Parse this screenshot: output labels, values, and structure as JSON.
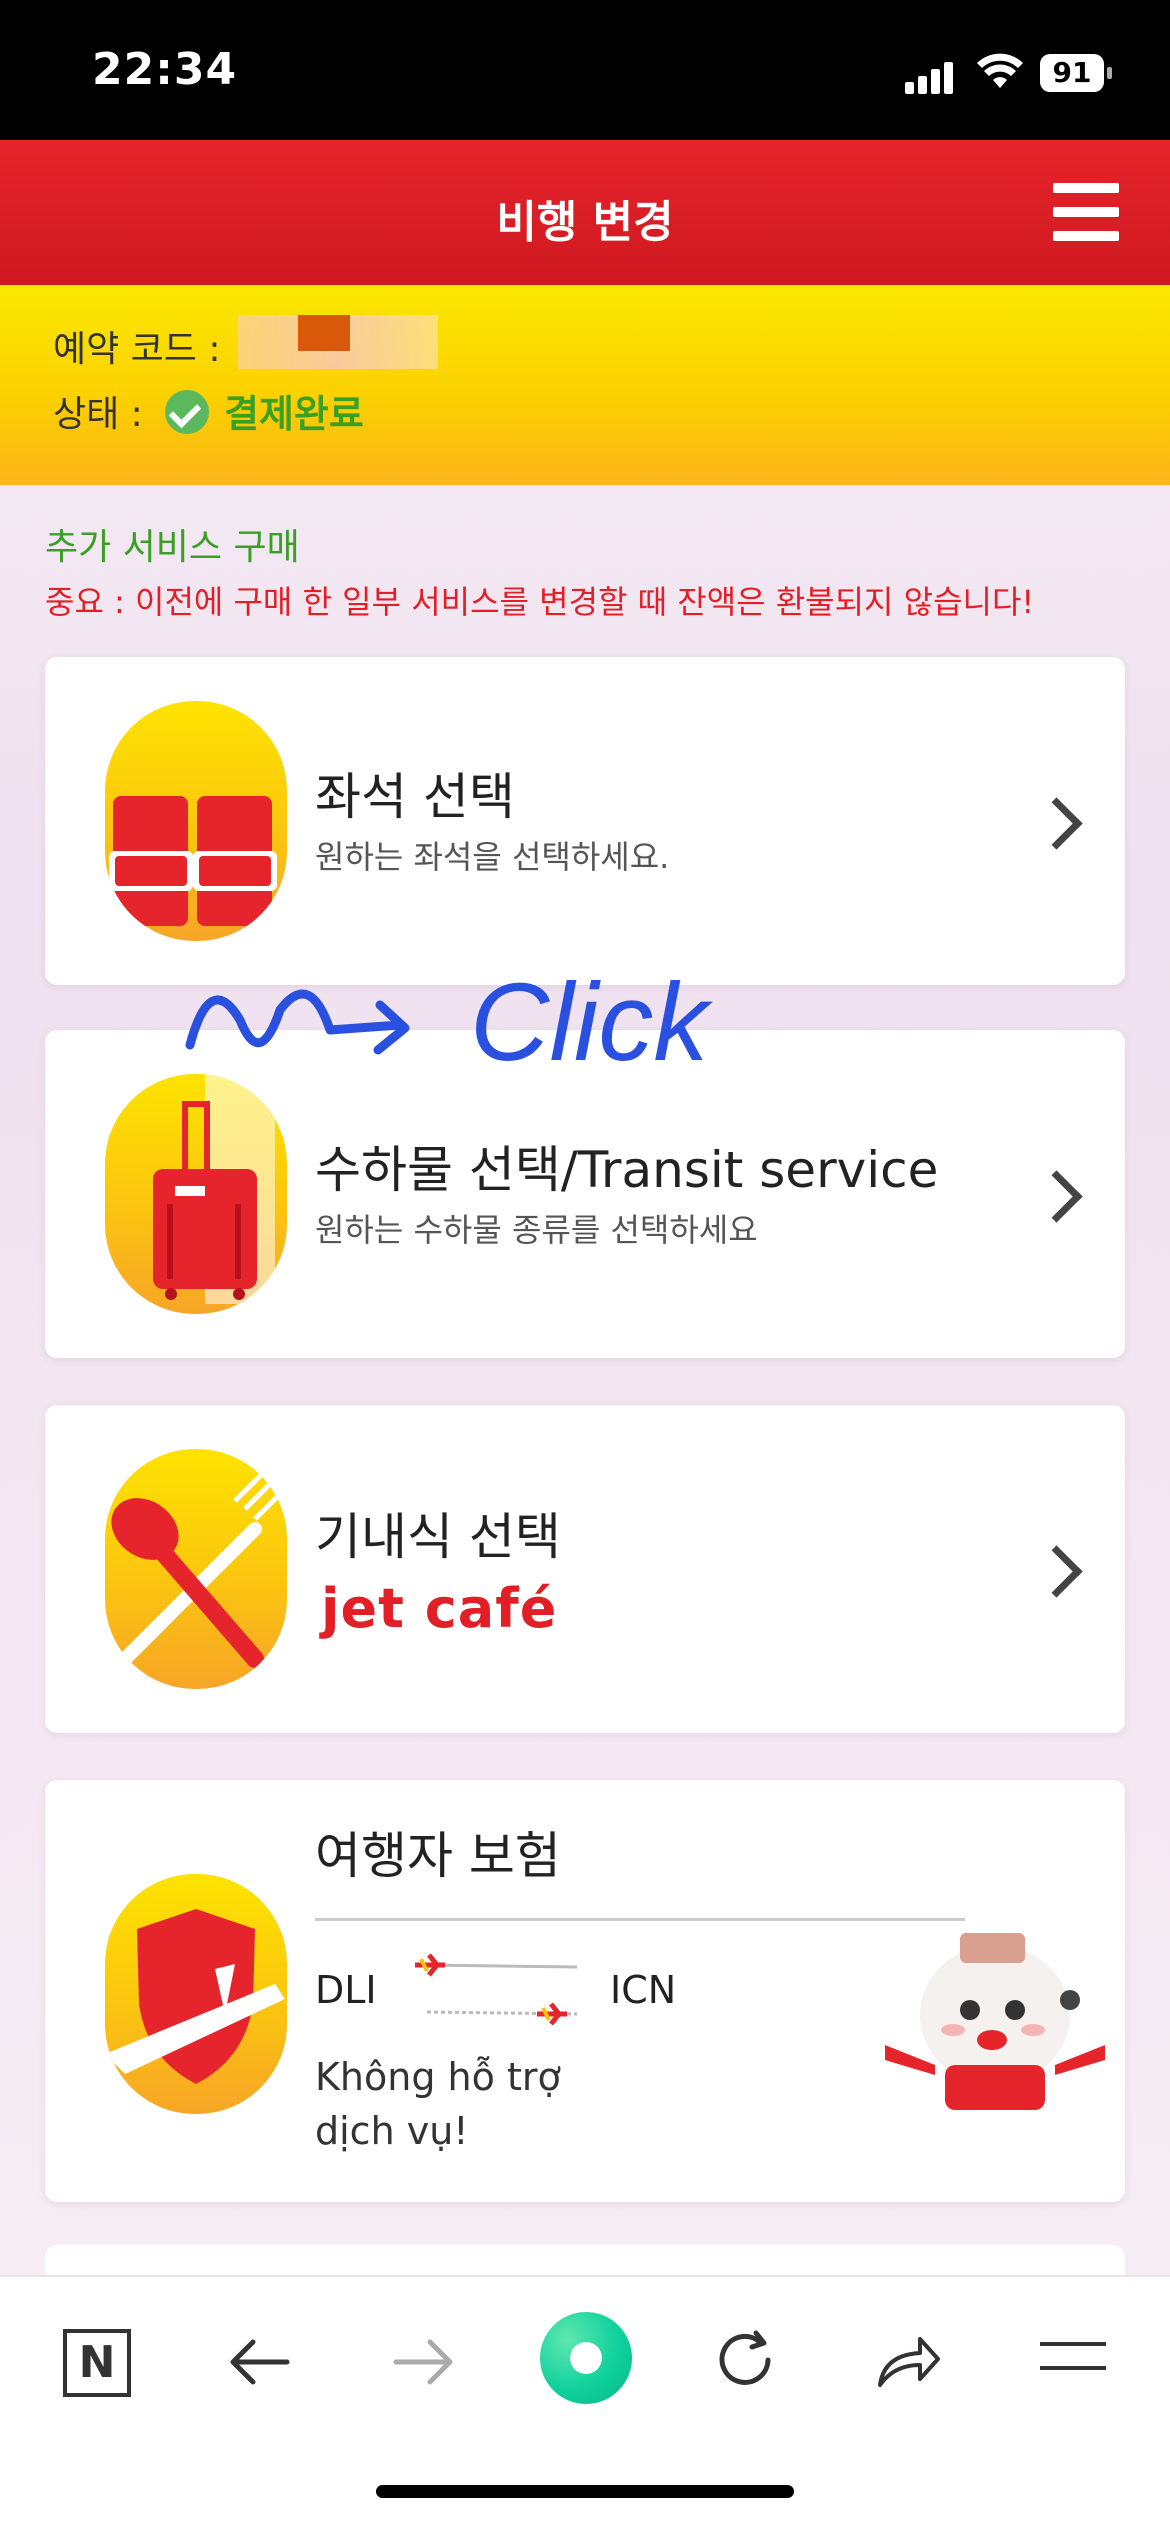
{
  "status_bar": {
    "time": "22:34",
    "battery": "91"
  },
  "header": {
    "title": "비행 변경",
    "menu_icon": "hamburger-icon"
  },
  "booking": {
    "code_label": "예약 코드 :",
    "status_label": "상태 :",
    "status_value": "결제완료"
  },
  "section": {
    "title": "추가 서비스 구매",
    "notice": "중요 : 이전에 구매 한 일부 서비스를 변경할 때 잔액은 환불되지 않습니다!"
  },
  "services": [
    {
      "title": "좌석 선택",
      "subtitle": "원하는 좌석을 선택하세요.",
      "icon": "seat-icon"
    },
    {
      "title": "수하물 선택/Transit service",
      "subtitle": "원하는 수하물 종류를 선택하세요",
      "icon": "luggage-icon"
    },
    {
      "title": "기내식 선택",
      "subtitle": "jet café",
      "icon": "meal-icon"
    },
    {
      "title": "여행자 보험",
      "from": "DLI",
      "to": "ICN",
      "message": "Không hỗ trợ dịch vụ!",
      "icon": "insurance-icon"
    }
  ],
  "annotation": "Click",
  "toolbar": {
    "n_label": "N",
    "icons": [
      "n-icon",
      "back-arrow-icon",
      "forward-arrow-icon",
      "green-circle-icon",
      "reload-icon",
      "share-icon",
      "menu-icon"
    ]
  },
  "colors": {
    "brand_red": "#e21f26",
    "brand_yellow": "#fbd100",
    "status_green": "#3aa024"
  }
}
